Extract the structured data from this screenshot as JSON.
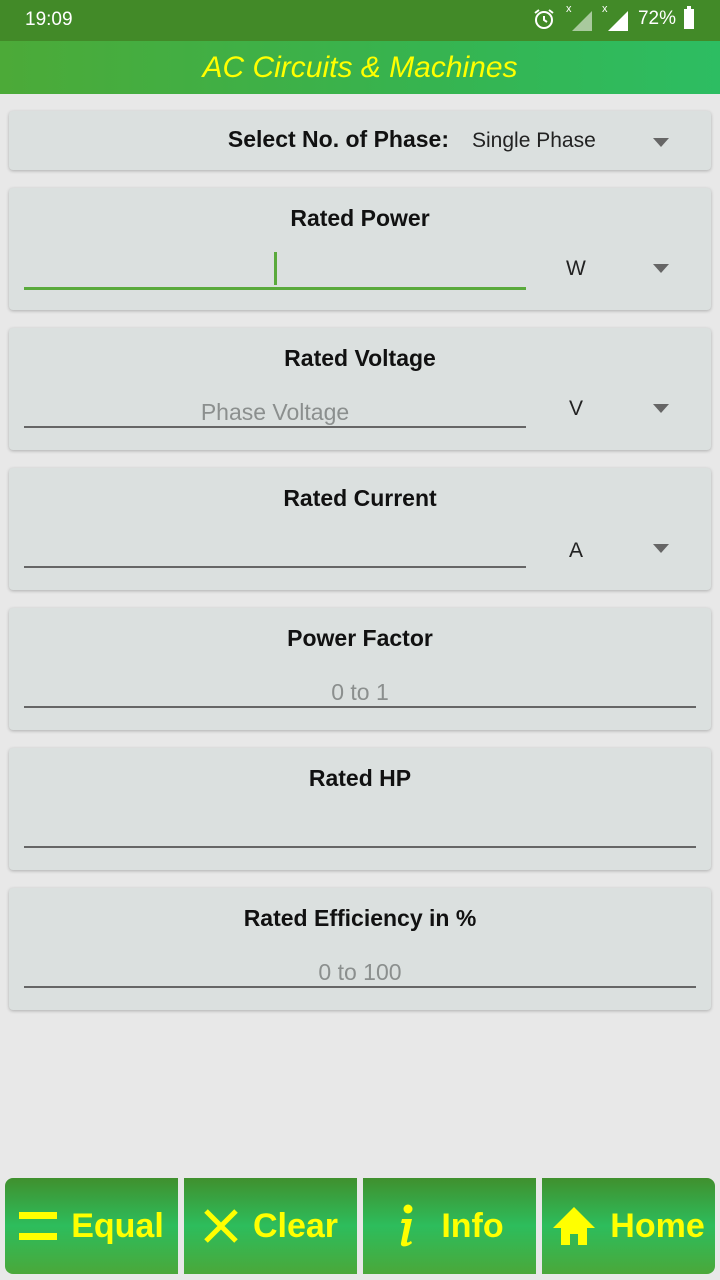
{
  "status_bar": {
    "time": "19:09",
    "battery": "72%",
    "icons": [
      "alarm-icon",
      "signal-icon-sim1",
      "signal-icon-sim2",
      "battery-icon"
    ],
    "signal_marker": "x"
  },
  "app_bar": {
    "title": "AC Circuits & Machines",
    "title_color": "#ffff00",
    "bg_color": "#3cb04a"
  },
  "phase": {
    "label": "Select No. of Phase:",
    "value": "Single Phase"
  },
  "fields": [
    {
      "title": "Rated Power",
      "value": "",
      "placeholder": "",
      "unit": "W",
      "focused": true
    },
    {
      "title": "Rated Voltage",
      "value": "",
      "placeholder": "Phase Voltage",
      "unit": "V"
    },
    {
      "title": "Rated Current",
      "value": "",
      "placeholder": "",
      "unit": "A"
    },
    {
      "title": "Power Factor",
      "value": "",
      "placeholder": "0 to 1"
    },
    {
      "title": "Rated HP",
      "value": "",
      "placeholder": ""
    },
    {
      "title": "Rated Efficiency in %",
      "value": "",
      "placeholder": "0 to 100"
    }
  ],
  "bottom_bar": {
    "buttons": [
      {
        "label": "Equal",
        "icon": "equals-icon"
      },
      {
        "label": "Clear",
        "icon": "close-icon"
      },
      {
        "label": "Info",
        "icon": "info-icon"
      },
      {
        "label": "Home",
        "icon": "home-icon"
      }
    ],
    "accent_color": "#ffff00"
  }
}
